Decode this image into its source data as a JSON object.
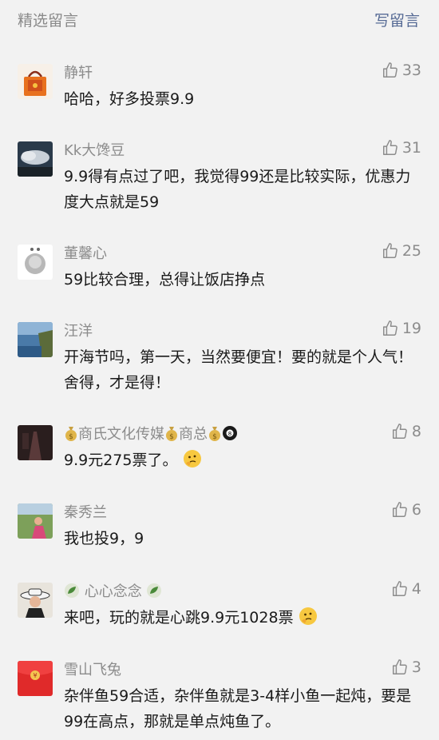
{
  "header": {
    "title": "精选留言",
    "write_label": "写留言"
  },
  "comments": [
    {
      "name": "静轩",
      "text": "哈哈，好多投票9.9",
      "likes": "33",
      "avatar": "shopping-bag-avatar"
    },
    {
      "name": "Kk大馋豆",
      "text": "9.9得有点过了吧，我觉得99还是比较实际，优惠力度大点就是59",
      "likes": "31",
      "avatar": "cloud-sky-avatar"
    },
    {
      "name": "董馨心",
      "text": "59比较合理，总得让饭店挣点",
      "likes": "25",
      "avatar": "person-sketch-avatar"
    },
    {
      "name": "汪洋",
      "text": "开海节吗，第一天，当然要便宜！要的就是个人气！舍得，才是得！",
      "likes": "19",
      "avatar": "sea-cliff-avatar"
    },
    {
      "name_parts": [
        "商氏文化传媒",
        "商总"
      ],
      "text": "9.9元275票了。",
      "likes": "8",
      "avatar": "dark-room-avatar"
    },
    {
      "name": "秦秀兰",
      "text": "我也投9，9",
      "likes": "6",
      "avatar": "outdoor-person-avatar"
    },
    {
      "name": "心心念念",
      "text": "来吧，玩的就是心跳9.9元1028票",
      "likes": "4",
      "avatar": "hat-woman-avatar"
    },
    {
      "name": "雪山飞兔",
      "text": "杂伴鱼59合适，杂伴鱼就是3-4样小鱼一起炖，要是99在高点，那就是单点炖鱼了。",
      "likes": "3",
      "avatar": "red-envelope-avatar"
    }
  ]
}
